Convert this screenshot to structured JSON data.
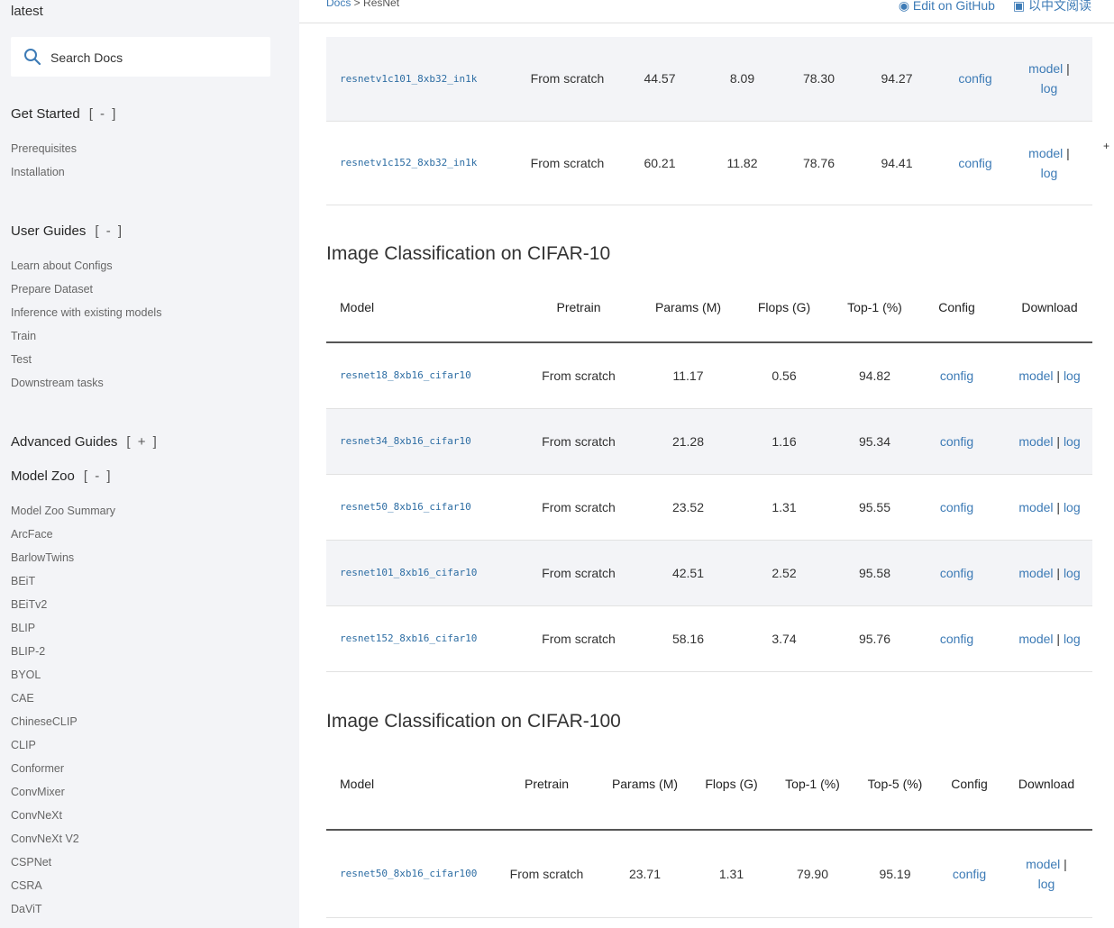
{
  "sidebar": {
    "version": "latest",
    "search_placeholder": "Search Docs",
    "sections": [
      {
        "label": "Get Started",
        "toggle": "[ - ]"
      },
      {
        "label": "User Guides",
        "toggle": "[ - ]"
      },
      {
        "label": "Advanced Guides",
        "toggle": "[ + ]"
      },
      {
        "label": "Model Zoo",
        "toggle": "[ - ]"
      }
    ],
    "get_started_items": [
      "Prerequisites",
      "Installation"
    ],
    "user_guides_items": [
      "Learn about Configs",
      "Prepare Dataset",
      "Inference with existing models",
      "Train",
      "Test",
      "Downstream tasks"
    ],
    "model_zoo_items": [
      "Model Zoo Summary",
      "ArcFace",
      "BarlowTwins",
      "BEiT",
      "BEiTv2",
      "BLIP",
      "BLIP-2",
      "BYOL",
      "CAE",
      "ChineseCLIP",
      "CLIP",
      "Conformer",
      "ConvMixer",
      "ConvNeXt",
      "ConvNeXt V2",
      "CSPNet",
      "CSRA",
      "DaViT"
    ]
  },
  "breadcrumb": {
    "docs": "Docs",
    "sep": " > ",
    "current": "ResNet"
  },
  "toplinks": {
    "edit": "Edit on GitHub",
    "chinese": "以中文阅读"
  },
  "side_plus": "+",
  "table1": {
    "rows": [
      {
        "model": "resnetv1c101_8xb32_in1k",
        "pretrain": "From scratch",
        "params": "44.57",
        "flops": "8.09",
        "top1": "78.30",
        "top5": "94.27",
        "config": "config",
        "model_link": "model",
        "sep": " |",
        "log": "log"
      },
      {
        "model": "resnetv1c152_8xb32_in1k",
        "pretrain": "From scratch",
        "params": "60.21",
        "flops": "11.82",
        "top1": "78.76",
        "top5": "94.41",
        "config": "config",
        "model_link": "model",
        "sep": " |",
        "log": "log"
      }
    ]
  },
  "cifar10": {
    "title": "Image Classification on CIFAR-10",
    "headers": [
      "Model",
      "Pretrain",
      "Params (M)",
      "Flops (G)",
      "Top-1 (%)",
      "Config",
      "Download"
    ],
    "rows": [
      {
        "model": "resnet18_8xb16_cifar10",
        "pretrain": "From scratch",
        "params": "11.17",
        "flops": "0.56",
        "top1": "94.82",
        "config": "config",
        "model_link": "model",
        "sep": " | ",
        "log": "log"
      },
      {
        "model": "resnet34_8xb16_cifar10",
        "pretrain": "From scratch",
        "params": "21.28",
        "flops": "1.16",
        "top1": "95.34",
        "config": "config",
        "model_link": "model",
        "sep": " | ",
        "log": "log"
      },
      {
        "model": "resnet50_8xb16_cifar10",
        "pretrain": "From scratch",
        "params": "23.52",
        "flops": "1.31",
        "top1": "95.55",
        "config": "config",
        "model_link": "model",
        "sep": " | ",
        "log": "log"
      },
      {
        "model": "resnet101_8xb16_cifar10",
        "pretrain": "From scratch",
        "params": "42.51",
        "flops": "2.52",
        "top1": "95.58",
        "config": "config",
        "model_link": "model",
        "sep": " | ",
        "log": "log"
      },
      {
        "model": "resnet152_8xb16_cifar10",
        "pretrain": "From scratch",
        "params": "58.16",
        "flops": "3.74",
        "top1": "95.76",
        "config": "config",
        "model_link": "model",
        "sep": " | ",
        "log": "log"
      }
    ]
  },
  "cifar100": {
    "title": "Image Classification on CIFAR-100",
    "headers": [
      "Model",
      "Pretrain",
      "Params (M)",
      "Flops (G)",
      "Top-1 (%)",
      "Top-5 (%)",
      "Config",
      "Download"
    ],
    "rows": [
      {
        "model": "resnet50_8xb16_cifar100",
        "pretrain": "From scratch",
        "params": "23.71",
        "flops": "1.31",
        "top1": "79.90",
        "top5": "95.19",
        "config": "config",
        "model_link": "model",
        "sep": " |",
        "log": "log"
      }
    ]
  },
  "colors": {
    "link": "#3d7bb6",
    "sidebar_bg": "#f3f4f7",
    "alt_row": "#f3f4f7"
  }
}
